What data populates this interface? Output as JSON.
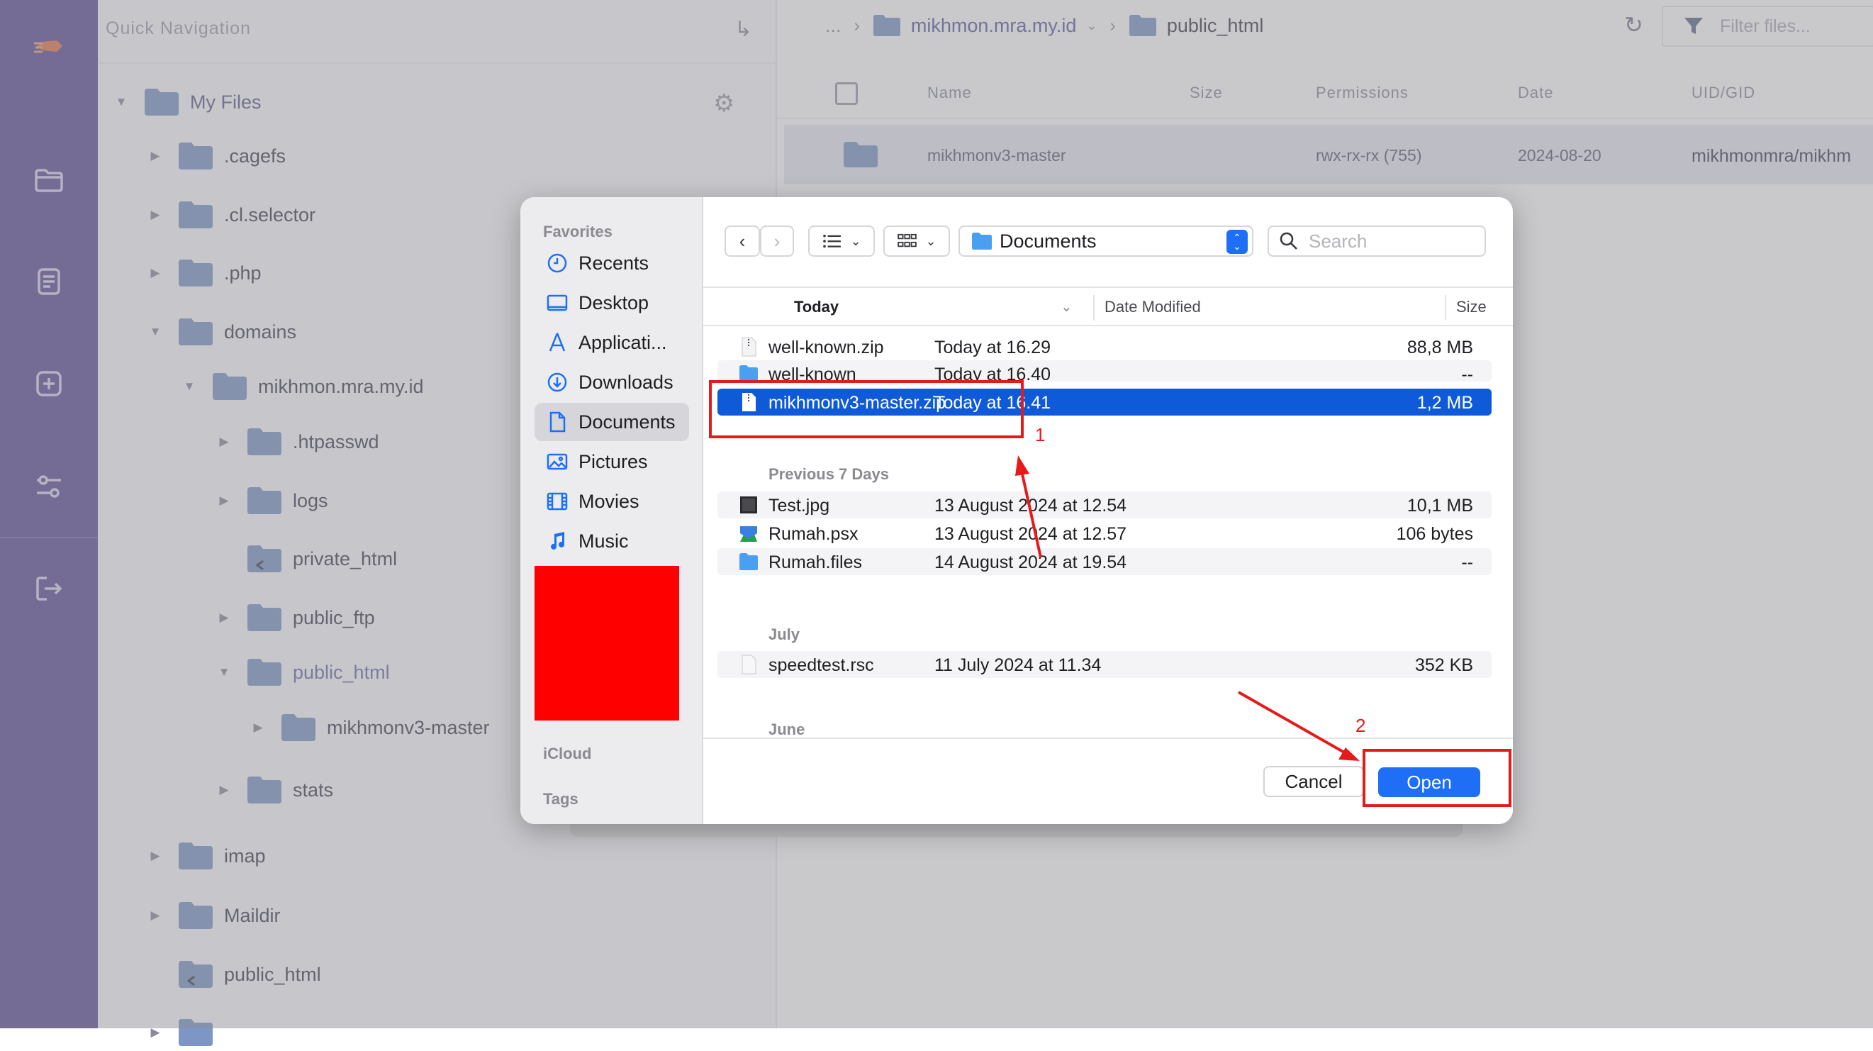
{
  "rail": {
    "icons": [
      "logo-icon",
      "folder-icon",
      "document-icon",
      "add-icon",
      "settings-sliders-icon",
      "logout-icon"
    ]
  },
  "nav": {
    "title": "Quick Navigation",
    "root": "My Files",
    "items": [
      ".cagefs",
      ".cl.selector",
      ".php",
      "domains",
      "mikhmon.mra.my.id",
      ".htpasswd",
      "logs",
      "private_html",
      "public_ftp",
      "public_html",
      "mikhmonv3-master",
      "stats",
      "imap",
      "Maildir",
      "public_html"
    ]
  },
  "main": {
    "breadcrumb": {
      "ellipsis": "...",
      "domain": "mikhmon.mra.my.id",
      "current": "public_html"
    },
    "filter_placeholder": "Filter files...",
    "columns": {
      "name": "Name",
      "size": "Size",
      "permissions": "Permissions",
      "date": "Date",
      "uid": "UID/GID"
    },
    "row": {
      "name": "mikhmonv3-master",
      "permissions": "rwx-rx-rx (755)",
      "date": "2024-08-20",
      "uid": "mikhmonmra/mikhm"
    }
  },
  "dialog": {
    "sidebar": {
      "favorites_header": "Favorites",
      "items": [
        "Recents",
        "Desktop",
        "Applicati...",
        "Downloads",
        "Documents",
        "Pictures",
        "Movies",
        "Music"
      ],
      "selected": "Documents",
      "icloud_header": "iCloud",
      "tags_header": "Tags"
    },
    "path": "Documents",
    "search_placeholder": "Search",
    "columns": {
      "name": "Today",
      "date": "Date Modified",
      "size": "Size"
    },
    "groups": {
      "previous7": "Previous 7 Days",
      "july": "July",
      "june": "June"
    },
    "files_today": [
      {
        "name": "well-known.zip",
        "date": "Today at 16.29",
        "size": "88,8 MB"
      },
      {
        "name": "well-known",
        "date": "Today at 16.40",
        "size": "--"
      },
      {
        "name": "mikhmonv3-master.zip",
        "date": "Today at 16.41",
        "size": "1,2 MB"
      }
    ],
    "files_previous7": [
      {
        "name": "Test.jpg",
        "date": "13 August 2024 at 12.54",
        "size": "10,1 MB"
      },
      {
        "name": "Rumah.psx",
        "date": "13 August 2024 at 12.57",
        "size": "106 bytes"
      },
      {
        "name": "Rumah.files",
        "date": "14 August 2024 at 19.54",
        "size": "--"
      }
    ],
    "files_july": [
      {
        "name": "speedtest.rsc",
        "date": "11 July 2024 at 11.34",
        "size": "352 KB"
      }
    ],
    "cancel_label": "Cancel",
    "open_label": "Open"
  },
  "annotations": {
    "step1": "1",
    "step2": "2"
  },
  "colors": {
    "accent": "#1e6ff5",
    "selection": "#0f5ad8",
    "annotation": "#e61a1a",
    "rail": "#5c4d96",
    "redaction": "#ff0000"
  }
}
